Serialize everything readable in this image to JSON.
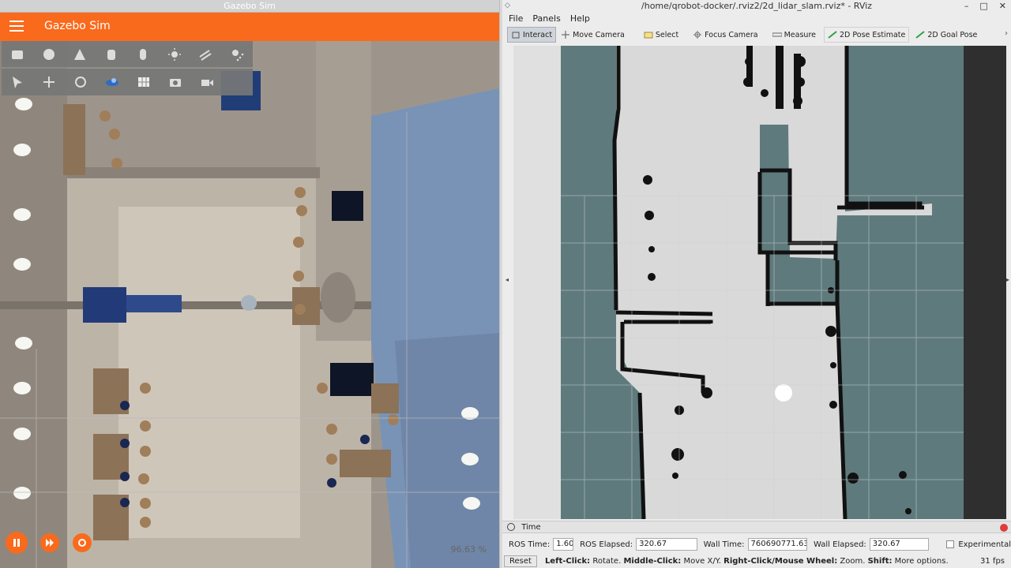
{
  "gazebo": {
    "window_title": "Gazebo Sim",
    "app_title": "Gazebo Sim",
    "toolbar_shapes": [
      "box-icon",
      "sphere-icon",
      "cone-icon",
      "cylinder-icon",
      "capsule-icon",
      "sun-light-icon",
      "directional-light-icon",
      "spot-light-icon"
    ],
    "toolbar_tools": [
      "select-arrow-icon",
      "translate-icon",
      "rotate-icon",
      "view-angle-icon",
      "grid-icon",
      "screenshot-icon",
      "record-video-icon"
    ],
    "rtf": "96.63 %",
    "colors": {
      "accent": "#fa6a1c"
    }
  },
  "rviz": {
    "window_title": "/home/qrobot-docker/.rviz2/2d_lidar_slam.rviz* - RViz",
    "menu": [
      "File",
      "Panels",
      "Help"
    ],
    "tools": [
      {
        "label": "Interact",
        "icon": "interact-icon",
        "active": true
      },
      {
        "label": "Move Camera",
        "icon": "move-camera-icon",
        "active": false
      },
      {
        "label": "Select",
        "icon": "select-icon",
        "active": false
      },
      {
        "label": "Focus Camera",
        "icon": "focus-camera-icon",
        "active": false
      },
      {
        "label": "Measure",
        "icon": "measure-icon",
        "active": false
      },
      {
        "label": "2D Pose Estimate",
        "icon": "pose-estimate-icon",
        "active": false
      },
      {
        "label": "2D Goal Pose",
        "icon": "goal-pose-icon",
        "active": false
      }
    ],
    "time_panel": {
      "title": "Time",
      "ros_time_label": "ROS Time:",
      "ros_time": "1.60",
      "ros_elapsed_label": "ROS Elapsed:",
      "ros_elapsed": "320.67",
      "wall_time_label": "Wall Time:",
      "wall_time": "760690771.63",
      "wall_elapsed_label": "Wall Elapsed:",
      "wall_elapsed": "320.67",
      "experimental_label": "Experimental"
    },
    "reset_label": "Reset",
    "help": {
      "left_key": "Left-Click:",
      "left_val": "Rotate.",
      "middle_key": "Middle-Click:",
      "middle_val": "Move X/Y.",
      "right_key": "Right-Click/Mouse Wheel:",
      "right_val": "Zoom.",
      "shift_key": "Shift:",
      "shift_val": "More options."
    },
    "fps": "31 fps",
    "colors": {
      "unknown": "#5f7a7d",
      "free": "#d9d9d9",
      "occupied": "#111111"
    }
  }
}
